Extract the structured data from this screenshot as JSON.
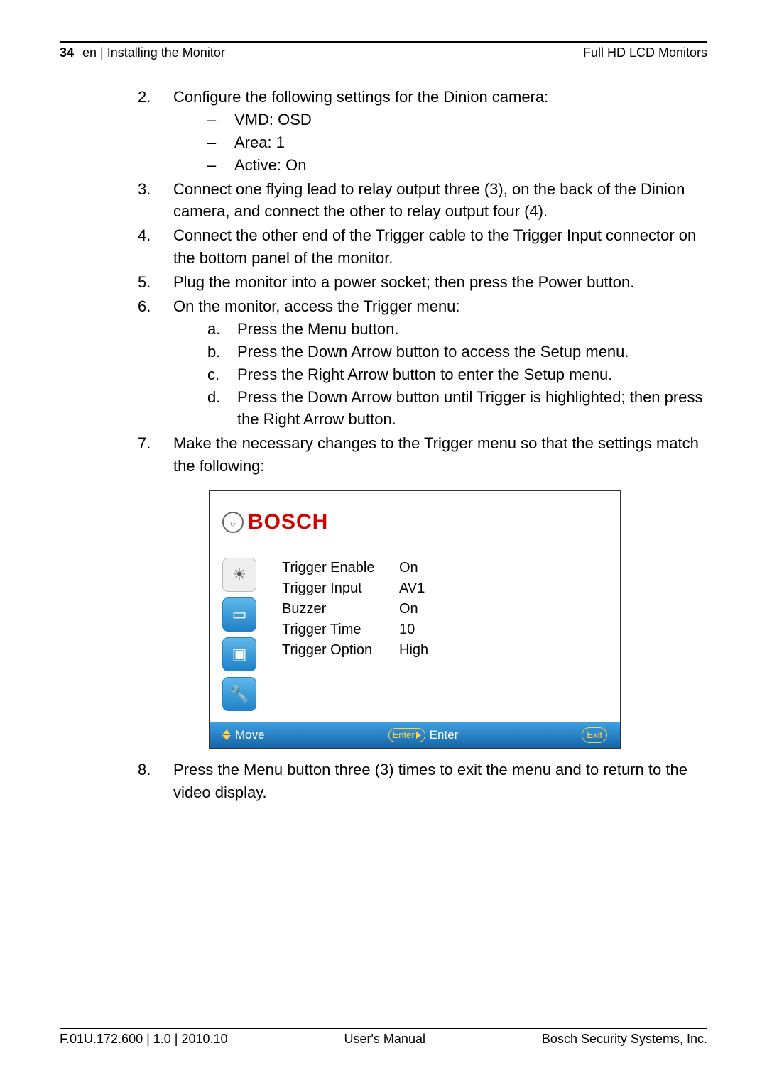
{
  "header": {
    "page_number": "34",
    "section": "en | Installing the Monitor",
    "doc_title": "Full HD LCD Monitors"
  },
  "steps": {
    "s2": {
      "text": "Configure the following settings for the Dinion camera:",
      "sub": {
        "a": "VMD: OSD",
        "b": "Area: 1",
        "c": "Active: On"
      }
    },
    "s3": "Connect one flying lead to relay output three (3), on the back of the Dinion camera, and connect the other to relay output four (4).",
    "s4": "Connect the other end of the Trigger cable to the Trigger Input connector on the bottom panel of the monitor.",
    "s5": "Plug the monitor into a power socket; then press the Power button.",
    "s6": {
      "text": "On the monitor, access the Trigger menu:",
      "sub": {
        "a": "Press the Menu button.",
        "b": "Press the Down Arrow button to access the Setup menu.",
        "c": "Press the Right Arrow button to enter the Setup menu.",
        "d": "Press the Down Arrow button until Trigger is highlighted; then press the Right Arrow button."
      }
    },
    "s7": "Make the necessary changes to the Trigger menu so that the settings match the following:",
    "s8": "Press the Menu button three (3) times to exit the menu and to return to the video display."
  },
  "osd": {
    "brand": "BOSCH",
    "rows": {
      "r1k": "Trigger Enable",
      "r1v": "On",
      "r2k": "Trigger Input",
      "r2v": "AV1",
      "r3k": "Buzzer",
      "r3v": "On",
      "r4k": "Trigger Time",
      "r4v": "10",
      "r5k": "Trigger Option",
      "r5v": "High"
    },
    "bar": {
      "move": "Move",
      "enter_pill": "Enter",
      "enter_lbl": "Enter",
      "exit": "Exit"
    }
  },
  "footer": {
    "left": "F.01U.172.600 | 1.0 | 2010.10",
    "center": "User's Manual",
    "right": "Bosch Security Systems, Inc."
  }
}
